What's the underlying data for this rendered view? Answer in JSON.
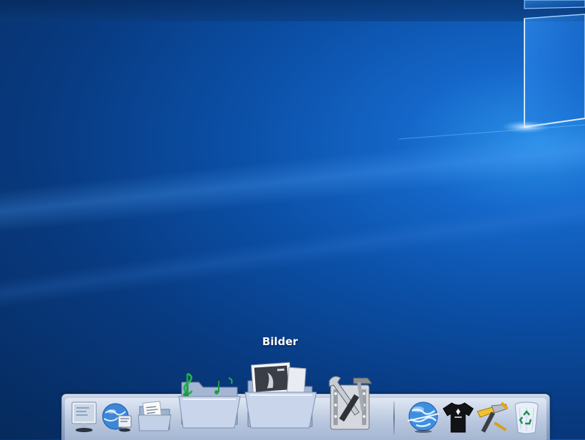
{
  "desktop": {
    "wallpaper": "windows-10-hero",
    "accent": "#1a78e0"
  },
  "tooltip": {
    "label": "Bilder"
  },
  "dock": {
    "items": [
      {
        "icon": "computer-icon"
      },
      {
        "icon": "network-icon"
      },
      {
        "icon": "documents-folder-icon"
      },
      {
        "icon": "music-folder-icon"
      },
      {
        "icon": "pictures-folder-icon"
      },
      {
        "icon": "system-tools-icon"
      },
      {
        "icon": "internet-globe-icon"
      },
      {
        "icon": "tshirt-icon"
      },
      {
        "icon": "hammer-tools-icon"
      },
      {
        "icon": "recycle-bin-icon"
      }
    ]
  }
}
